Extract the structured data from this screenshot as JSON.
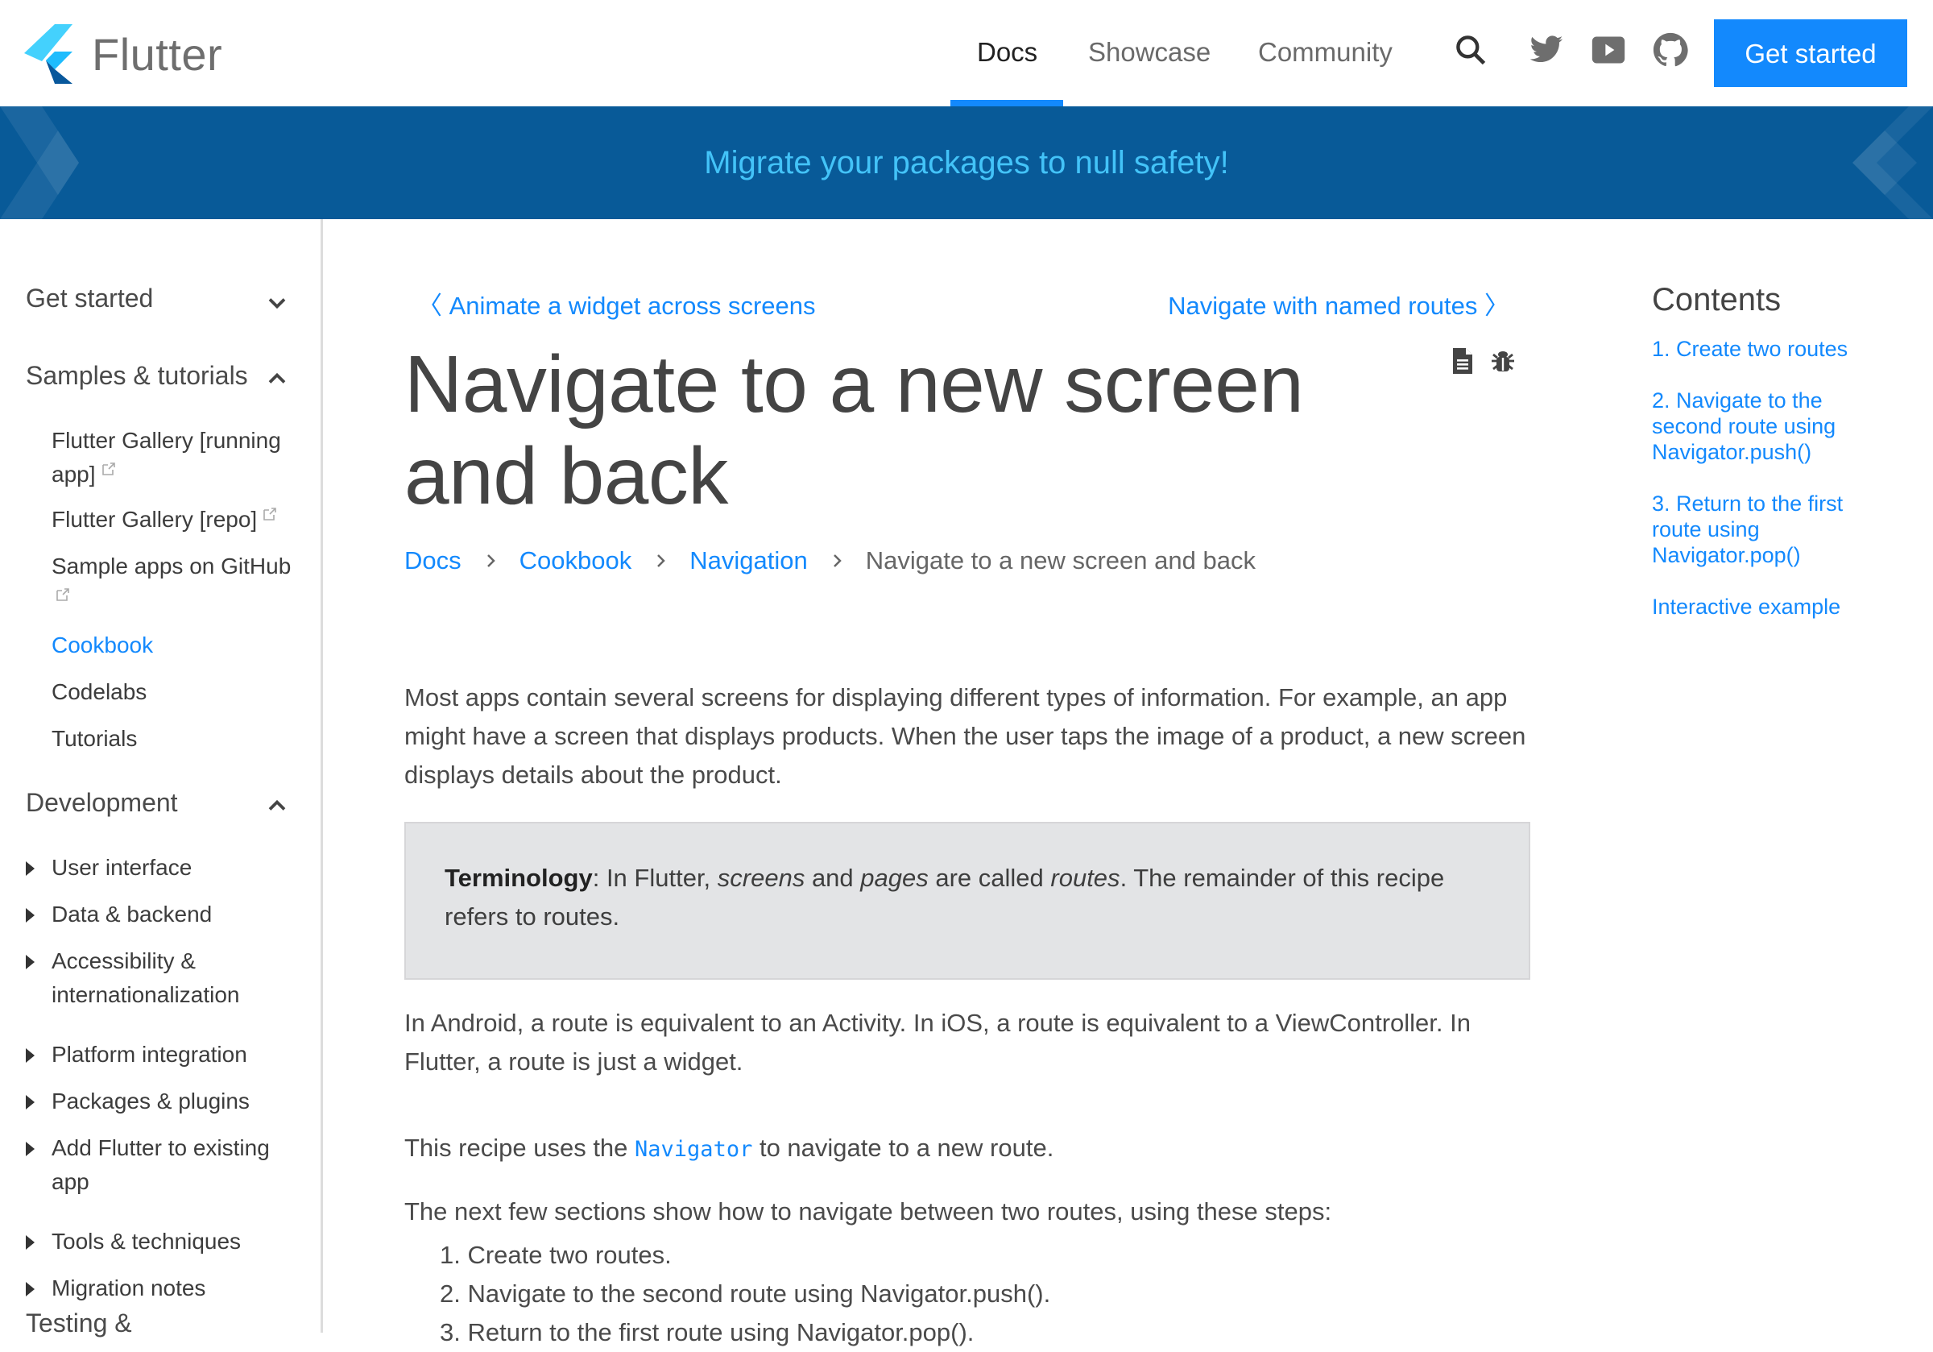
{
  "header": {
    "brand": "Flutter",
    "nav": [
      {
        "label": "Docs",
        "active": true
      },
      {
        "label": "Showcase",
        "active": false
      },
      {
        "label": "Community",
        "active": false
      }
    ],
    "icons": [
      "search-icon",
      "twitter-icon",
      "youtube-icon",
      "github-icon"
    ],
    "cta_label": "Get started"
  },
  "banner": {
    "text": "Migrate your packages to null safety!"
  },
  "sidebar": {
    "sections": [
      {
        "label": "Get started",
        "expanded": false
      },
      {
        "label": "Samples & tutorials",
        "expanded": true,
        "items": [
          {
            "label": "Flutter Gallery [running app]",
            "external": true
          },
          {
            "label": "Flutter Gallery [repo]",
            "external": true
          },
          {
            "label": "Sample apps on GitHub",
            "external": true
          },
          {
            "label": "Cookbook",
            "active": true
          },
          {
            "label": "Codelabs"
          },
          {
            "label": "Tutorials"
          }
        ]
      },
      {
        "label": "Development",
        "expanded": true,
        "items": [
          {
            "label": "User interface"
          },
          {
            "label": "Data & backend"
          },
          {
            "label": "Accessibility & internationalization"
          },
          {
            "label": "Platform integration"
          },
          {
            "label": "Packages & plugins"
          },
          {
            "label": "Add Flutter to existing app"
          },
          {
            "label": "Tools & techniques"
          },
          {
            "label": "Migration notes"
          }
        ]
      },
      {
        "label": "Testing &"
      }
    ]
  },
  "main": {
    "prev": "Animate a widget across screens",
    "next": "Navigate with named routes",
    "title": "Navigate to a new screen and back",
    "breadcrumb": [
      "Docs",
      "Cookbook",
      "Navigation",
      "Navigate to a new screen and back"
    ],
    "intro": "Most apps contain several screens for displaying different types of information. For example, an app might have a screen that displays products. When the user taps the image of a product, a new screen displays details about the product.",
    "note": {
      "bold": "Terminology",
      "t1": ": In Flutter, ",
      "i1": "screens",
      "t2": " and ",
      "i2": "pages",
      "t3": " are called ",
      "i3": "routes",
      "t4": ". The remainder of this recipe refers to routes."
    },
    "p2": "In Android, a route is equivalent to an Activity. In iOS, a route is equivalent to a ViewController. In Flutter, a route is just a widget.",
    "p3_before": "This recipe uses the ",
    "p3_code": "Navigator",
    "p3_after": " to navigate to a new route.",
    "p4": "The next few sections show how to navigate between two routes, using these steps:",
    "steps": [
      "1. Create two routes.",
      "2. Navigate to the second route using Navigator.push().",
      "3. Return to the first route using Navigator.pop()."
    ]
  },
  "toc": {
    "title": "Contents",
    "items": [
      "1. Create two routes",
      "2. Navigate to the second route using Navigator.push()",
      "3. Return to the first route using Navigator.pop()",
      "Interactive example"
    ]
  },
  "colors": {
    "accent": "#1389fd",
    "banner_bg": "#085a98",
    "banner_text": "#43c3f8",
    "note_bg": "#e3e4e6"
  }
}
